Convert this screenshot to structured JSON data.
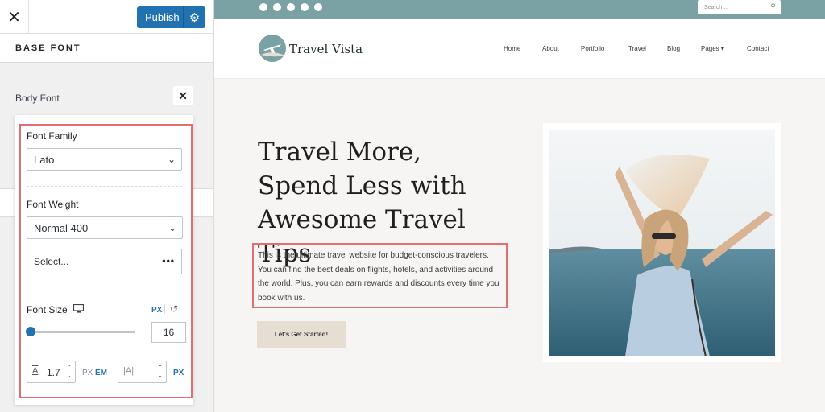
{
  "customizer": {
    "close_icon": "close-icon",
    "publish_label": "Publish",
    "gear_icon": "gear-icon",
    "section_title": "BASE FONT",
    "body_font_label": "Body Font",
    "font_family": {
      "label": "Font Family",
      "value": "Lato"
    },
    "font_weight": {
      "label": "Font Weight",
      "value": "Normal 400"
    },
    "style_select": {
      "placeholder": "Select...",
      "more_icon": "ellipsis-icon"
    },
    "font_size": {
      "label": "Font Size",
      "unit": "PX",
      "value": "16",
      "slider_fraction": 0.0
    },
    "line_height": {
      "value": "1.7",
      "unit_px": "PX",
      "unit_em": "EM"
    },
    "letter_spacing": {
      "placeholder": "|A|",
      "unit": "PX"
    }
  },
  "site": {
    "social_icons": [
      "facebook-icon",
      "twitter-icon",
      "youtube-icon",
      "instagram-icon",
      "pinterest-icon"
    ],
    "search_placeholder": "Search ...",
    "brand_name": "Travel Vista",
    "nav": [
      "Home",
      "About",
      "Portfolio",
      "Travel",
      "Blog",
      "Pages ▾",
      "Contact"
    ],
    "hero_title": "Travel More, Spend Less with Awesome Travel Tips",
    "hero_text": "This is the ultimate travel website for budget-conscious travelers. You can find the best deals on flights, hotels, and activities around the world. Plus, you can earn rewards and discounts every time you book with us.",
    "cta_label": "Let's Get Started!"
  },
  "colors": {
    "publish_blue": "#2271b1",
    "highlight": "#e07070",
    "topbar": "#7aa1a3",
    "cta_bg": "#e6ddd3"
  }
}
